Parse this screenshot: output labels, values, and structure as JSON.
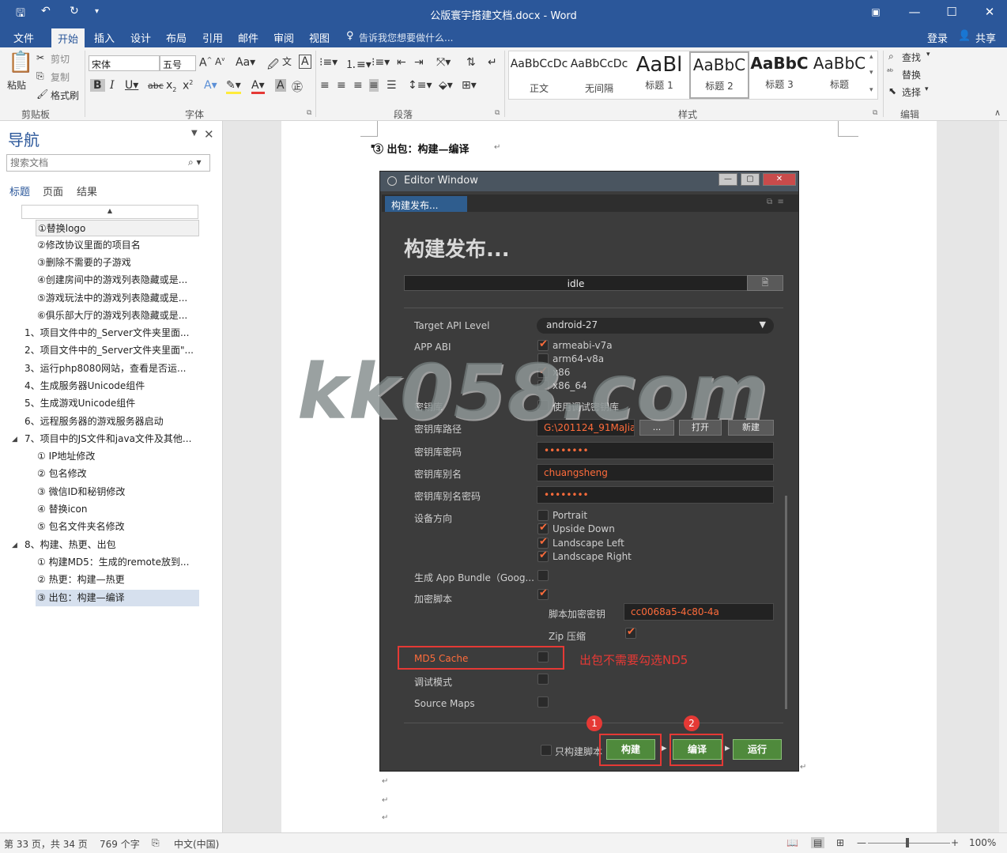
{
  "window": {
    "title": "公版寰宇搭建文档.docx - Word"
  },
  "ribbon_tabs": [
    "文件",
    "开始",
    "插入",
    "设计",
    "布局",
    "引用",
    "邮件",
    "审阅",
    "视图"
  ],
  "tell_me": "告诉我您想要做什么...",
  "account": {
    "login": "登录",
    "share": "共享"
  },
  "clipboard": {
    "paste": "粘贴",
    "cut": "剪切",
    "copy": "复制",
    "format_painter": "格式刷",
    "group": "剪贴板"
  },
  "font": {
    "name": "宋体",
    "size": "五号",
    "group": "字体"
  },
  "paragraph": {
    "group": "段落"
  },
  "styles": {
    "group": "样式",
    "items": [
      {
        "preview": "AaBbCcDc",
        "name": "正文"
      },
      {
        "preview": "AaBbCcDc",
        "name": "无间隔"
      },
      {
        "preview": "AaBl",
        "name": "标题 1"
      },
      {
        "preview": "AaBbC",
        "name": "标题 2"
      },
      {
        "preview": "AaBbC",
        "name": "标题 3"
      },
      {
        "preview": "AaBbC",
        "name": "标题"
      }
    ]
  },
  "editing": {
    "find": "查找",
    "replace": "替换",
    "select": "选择",
    "group": "编辑"
  },
  "nav": {
    "title": "导航",
    "search_placeholder": "搜索文档",
    "tabs": [
      "标题",
      "页面",
      "结果"
    ],
    "items": [
      "①替换logo",
      "②修改协议里面的项目名",
      "③删除不需要的子游戏",
      "④创建房间中的游戏列表隐藏或是...",
      "⑤游戏玩法中的游戏列表隐藏或是...",
      "⑥俱乐部大厅的游戏列表隐藏或是...",
      "1、项目文件中的_Server文件夹里面...",
      "2、项目文件中的_Server文件夹里面\"...",
      "3、运行php8080网站，查看是否运...",
      "4、生成服务器Unicode组件",
      "5、生成游戏Unicode组件",
      "6、远程服务器的游戏服务器启动",
      "7、项目中的JS文件和java文件及其他...",
      "① IP地址修改",
      "② 包名修改",
      "③ 微信ID和秘钥修改",
      "④ 替换icon",
      "⑤ 包名文件夹名修改",
      "8、构建、热更、出包",
      "① 构建MD5：生成的remote放到...",
      "② 热更：构建—热更",
      "③ 出包：构建—编译"
    ]
  },
  "document": {
    "heading": "③ 出包：构建—编译"
  },
  "editor_window": {
    "title": "Editor Window",
    "tab": "构建发布...",
    "heading": "构建发布...",
    "status": "idle",
    "target_api_label": "Target API Level",
    "target_api_value": "android-27",
    "app_abi_label": "APP ABI",
    "abi_options": [
      {
        "label": "armeabi-v7a",
        "checked": true
      },
      {
        "label": "arm64-v8a",
        "checked": false
      },
      {
        "label": "x86",
        "checked": true
      },
      {
        "label": "x86_64",
        "checked": false
      }
    ],
    "keystore_label": "密钥库",
    "keystore_debug": "使用调试密钥库",
    "keystore_path_label": "密钥库路径",
    "keystore_path_value": "G:\\201124_91MaJia",
    "btn_dots": "...",
    "btn_open": "打开",
    "btn_new": "新建",
    "keystore_password_label": "密钥库密码",
    "keystore_password_value": "••••••••",
    "alias_label": "密钥库别名",
    "alias_value": "chuangsheng",
    "alias_password_label": "密钥库别名密码",
    "alias_password_value": "••••••••",
    "orientation_label": "设备方向",
    "orientations": [
      {
        "label": "Portrait",
        "checked": false
      },
      {
        "label": "Upside Down",
        "checked": true
      },
      {
        "label": "Landscape Left",
        "checked": true
      },
      {
        "label": "Landscape Right",
        "checked": true
      }
    ],
    "app_bundle_label": "生成 App Bundle（Goog...",
    "encrypt_label": "加密脚本",
    "encrypt_key_label": "脚本加密密钥",
    "encrypt_key_value": "cc0068a5-4c80-4a",
    "zip_label": "Zip 压缩",
    "md5_label": "MD5 Cache",
    "debug_label": "调试模式",
    "sourcemaps_label": "Source Maps",
    "only_build_script": "只构建脚本",
    "btn_build": "构建",
    "btn_compile": "编译",
    "btn_run": "运行",
    "annotation": "出包不需要勾选ND5",
    "badge1": "1",
    "badge2": "2"
  },
  "watermark": "kk058.com",
  "statusbar": {
    "page": "第 33 页，共 34 页",
    "words": "769 个字",
    "language": "中文(中国)",
    "zoom": "100%"
  },
  "colors": {
    "word_blue": "#2b579a",
    "accent_orange": "#ff6c3b",
    "annotation_red": "#e53935",
    "button_green": "#4f8a3c"
  }
}
